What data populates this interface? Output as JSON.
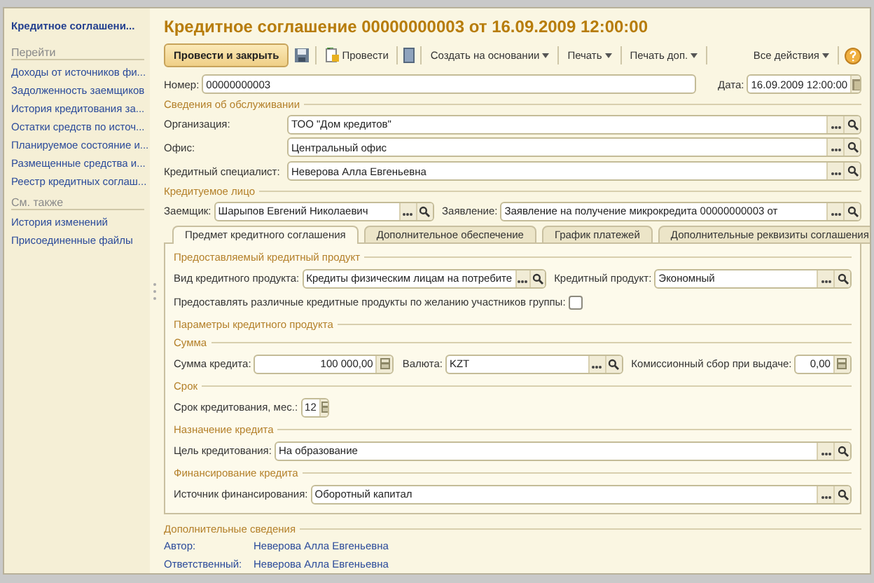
{
  "sidebar": {
    "title": "Кредитное соглашени...",
    "sections": [
      {
        "heading": "Перейти",
        "items": [
          "Доходы от источников фи...",
          "Задолженность заемщиков",
          "История кредитования за...",
          "Остатки средств по источ...",
          "Планируемое состояние и...",
          "Размещенные средства и...",
          "Реестр кредитных соглаш..."
        ]
      },
      {
        "heading": "См. также",
        "items": [
          "История изменений",
          "Присоединенные файлы"
        ]
      }
    ]
  },
  "title": "Кредитное соглашение 00000000003 от 16.09.2009 12:00:00",
  "toolbar": {
    "primary": "Провести и закрыть",
    "post": "Провести",
    "menus": [
      "Создать на основании",
      "Печать",
      "Печать доп."
    ],
    "all_actions": "Все действия"
  },
  "header_fields": [
    {
      "label": "Номер:",
      "value": "00000000003",
      "kind": "text"
    },
    {
      "label": "Дата:",
      "value": "16.09.2009 12:00:00",
      "kind": "date"
    }
  ],
  "groups": [
    {
      "heading": "Сведения об обслуживании",
      "rows": [
        [
          {
            "label": "Организация:",
            "value": "ТОО \"Дом кредитов\"",
            "kind": "select"
          }
        ],
        [
          {
            "label": "Офис:",
            "value": "Центральный офис",
            "kind": "select"
          }
        ],
        [
          {
            "label": "Кредитный специалист:",
            "value": "Неверова Алла Евгеньевна",
            "kind": "select"
          }
        ]
      ]
    },
    {
      "heading": "Кредитуемое лицо",
      "rows": [
        [
          {
            "label": "Заемщик:",
            "value": "Шарыпов Евгений Николаевич",
            "kind": "select"
          },
          {
            "label": "Заявление:",
            "value": "Заявление на получение микрокредита 00000000003 от",
            "kind": "select"
          }
        ]
      ]
    }
  ],
  "tabs": [
    {
      "label": "Предмет кредитного соглашения",
      "selected": true
    },
    {
      "label": "Дополнительное обеспечение",
      "selected": false
    },
    {
      "label": "График платежей",
      "selected": false
    },
    {
      "label": "Дополнительные реквизиты соглашения",
      "selected": false
    }
  ],
  "tab_sections": [
    {
      "heading": "Предоставляемый кредитный продукт",
      "rows": [
        [
          {
            "label": "Вид кредитного продукта:",
            "value": "Кредиты физическим лицам на потребите",
            "kind": "select"
          },
          {
            "label": "Кредитный продукт:",
            "value": "Экономный",
            "kind": "select"
          }
        ],
        [
          {
            "label": "Предоставлять различные кредитные продукты по желанию участников группы:",
            "checked": false,
            "kind": "checkbox"
          }
        ]
      ]
    },
    {
      "heading": "Параметры кредитного продукта"
    },
    {
      "heading": "Сумма",
      "rows": [
        [
          {
            "label": "Сумма кредита:",
            "value": "100 000,00",
            "kind": "calc"
          },
          {
            "label": "Валюта:",
            "value": "KZT",
            "kind": "select"
          },
          {
            "label": "Комиссионный сбор при выдаче:",
            "value": "0,00",
            "kind": "calc"
          }
        ]
      ]
    },
    {
      "heading": "Срок",
      "rows": [
        [
          {
            "label": "Срок кредитования, мес.:",
            "value": "12",
            "kind": "calc"
          }
        ]
      ]
    },
    {
      "heading": "Назначение кредита",
      "rows": [
        [
          {
            "label": "Цель кредитования:",
            "value": "На образование",
            "kind": "select"
          }
        ]
      ]
    },
    {
      "heading": "Финансирование кредита",
      "rows": [
        [
          {
            "label": "Источник финансирования:",
            "value": "Оборотный капитал",
            "kind": "select"
          }
        ]
      ]
    }
  ],
  "extra": {
    "heading": "Дополнительные сведения",
    "items": [
      {
        "label": "Автор:",
        "value": "Неверова Алла Евгеньевна"
      },
      {
        "label": "Ответственный:",
        "value": "Неверова Алла Евгеньевна"
      }
    ]
  }
}
